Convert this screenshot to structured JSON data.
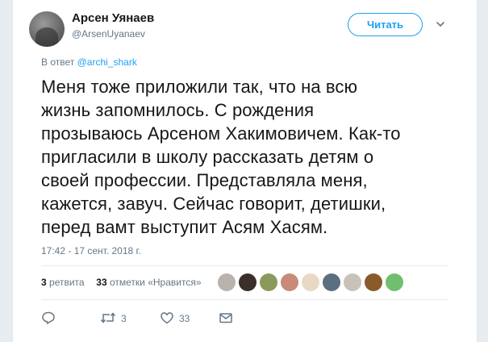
{
  "tweet": {
    "author_name": "Арсен Уянаев",
    "author_handle": "@ArsenUyanaev",
    "follow_label": "Читать",
    "reply_prefix": "В ответ",
    "reply_mention": "@archi_shark",
    "text_lines": [
      "Меня тоже приложили так, что на всю",
      "жизнь запомнилось. С рождения",
      "прозываюсь Арсеном Хакимовичем. Как-то",
      "пригласили в школу рассказать детям о",
      "своей профессии. Представляла меня,",
      "кажется, завуч. Сейчас говорит, детишки,",
      "перед вамт выступит Асям Хасям."
    ],
    "timestamp": "17:42 - 17 сент. 2018 г.",
    "retweets_count": "3",
    "retweets_label": "ретвита",
    "likes_count": "33",
    "likes_label": "отметки «Нравится»"
  },
  "likers": [
    {
      "icon": "avatar-1",
      "color": "#b9b3ae"
    },
    {
      "icon": "avatar-2",
      "color": "#3a2f2a"
    },
    {
      "icon": "avatar-3",
      "color": "#8a9a5b"
    },
    {
      "icon": "avatar-4",
      "color": "#c98a7a"
    },
    {
      "icon": "avatar-5",
      "color": "#e8d9c4"
    },
    {
      "icon": "avatar-6",
      "color": "#5a6f7f"
    },
    {
      "icon": "avatar-7",
      "color": "#c8c2b8"
    },
    {
      "icon": "avatar-8",
      "color": "#8a5a2a"
    },
    {
      "icon": "avatar-9",
      "color": "#6fbf6f"
    }
  ],
  "actions": {
    "reply_icon": "reply-icon",
    "retweet_icon": "retweet-icon",
    "retweet_count": "3",
    "like_icon": "heart-icon",
    "like_count": "33",
    "dm_icon": "envelope-icon"
  },
  "colors": {
    "accent": "#1da1f2",
    "text": "#14171a",
    "secondary": "#657786",
    "background": "#e6ecf0"
  }
}
